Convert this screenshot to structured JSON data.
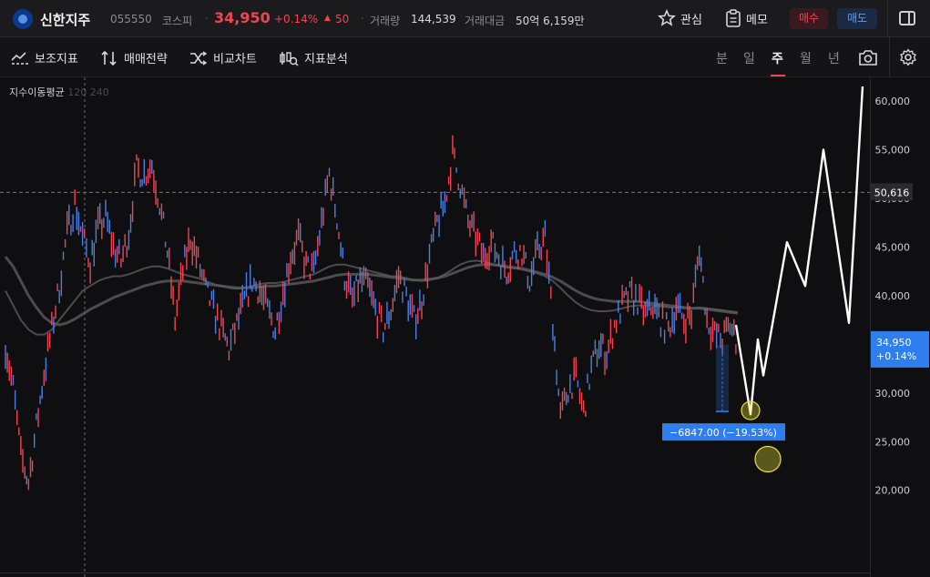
{
  "header": {
    "stock_name": "신한지주",
    "stock_code": "055550",
    "market": "코스피",
    "price": "34,950",
    "change_pct": "+0.14%",
    "change_arrow": "▲",
    "change_amount": "50",
    "volume_label": "거래량",
    "volume_value": "144,539",
    "trade_value_label": "거래대금",
    "trade_value": "50억 6,159만",
    "fav_label": "관심",
    "memo_label": "메모",
    "buy_label": "매수",
    "sell_label": "매도"
  },
  "toolbar": {
    "tools": [
      "보조지표",
      "매매전략",
      "비교차트",
      "지표분석"
    ],
    "periods": [
      "분",
      "일",
      "주",
      "월",
      "년"
    ],
    "active_period": "주"
  },
  "indicator": {
    "name": "지수이동평균",
    "params": "120 240"
  },
  "colors": {
    "up": "#f04452",
    "down": "#4a7fe0",
    "accent_blue": "#2f7ef0",
    "ma": "#5a5a60",
    "drawing": "#ffffff",
    "marker": "#e8e03a"
  },
  "chart_data": {
    "type": "line",
    "title": "",
    "xlabel": "",
    "ylabel": "",
    "ylim": [
      17000,
      61500
    ],
    "y_ticks": [
      "60,000",
      "55,000",
      "50,000",
      "45,000",
      "40,000",
      "35,000",
      "30,000",
      "25,000",
      "20,000"
    ],
    "y_tick_values": [
      60000,
      55000,
      50000,
      45000,
      40000,
      35000,
      30000,
      25000,
      20000
    ],
    "grid": false,
    "series": [
      {
        "kind": "price",
        "values": [
          35000,
          30500,
          23500,
          20800,
          26500,
          32000,
          36500,
          41000,
          46500,
          49500,
          46000,
          43500,
          47000,
          48000,
          45000,
          43500,
          46500,
          53000,
          52500,
          53500,
          49500,
          44500,
          37500,
          42500,
          46000,
          43500,
          40500,
          38500,
          36500,
          34500,
          37000,
          39500,
          41500,
          40500,
          38500,
          36500,
          40500,
          44000,
          46000,
          43000,
          42500,
          47500,
          52500,
          48000,
          42000,
          39500,
          41500,
          41000,
          38500,
          36500,
          38500,
          42000,
          40000,
          37500,
          39500,
          44000,
          47500,
          49500,
          54500,
          51500,
          47500,
          46000,
          44000,
          45500,
          44000,
          42500,
          44500,
          44500,
          41500,
          44500,
          46000,
          37500,
          27500,
          30500,
          31500,
          28000,
          32500,
          35000,
          34000,
          37000,
          39000,
          40000,
          39500,
          38000,
          39000,
          37500,
          36500,
          39000,
          37500,
          38000,
          45000,
          37500,
          36000,
          35500,
          37000,
          34950
        ]
      },
      {
        "kind": "ma120",
        "values": [
          40500,
          39000,
          37500,
          36500,
          36000,
          36000,
          36500,
          37500,
          38500,
          39500,
          40500,
          41000,
          41500,
          41800,
          42000,
          42000,
          42200,
          42500,
          42800,
          43000,
          43000,
          42800,
          42500,
          42200,
          42000,
          41800,
          41500,
          41200,
          41000,
          40800,
          40700,
          40800,
          41000,
          41200,
          41300,
          41300,
          41400,
          41600,
          41800,
          42000,
          42200,
          42600,
          43000,
          43200,
          43200,
          43000,
          42800,
          42600,
          42400,
          42200,
          42000,
          42000,
          41800,
          41600,
          41500,
          41600,
          41800,
          42200,
          42700,
          43200,
          43500,
          43600,
          43500,
          43300,
          43100,
          42900,
          42800,
          42700,
          42500,
          42300,
          42000,
          41500,
          40800,
          40000,
          39300,
          38800,
          38500,
          38400,
          38400,
          38500,
          38700,
          38900,
          39000,
          39000,
          39000,
          38900,
          38800,
          38800,
          38700,
          38700,
          38800,
          38700,
          38600,
          38500,
          38400,
          38300
        ]
      },
      {
        "kind": "ma240",
        "values": [
          44000,
          43000,
          41500,
          40000,
          38800,
          37800,
          37200,
          37000,
          37200,
          37600,
          38100,
          38600,
          39000,
          39400,
          39800,
          40100,
          40400,
          40700,
          41000,
          41200,
          41400,
          41500,
          41500,
          41500,
          41400,
          41300,
          41200,
          41100,
          41000,
          40900,
          40800,
          40800,
          40800,
          40900,
          41000,
          41000,
          41100,
          41200,
          41300,
          41400,
          41500,
          41700,
          41900,
          42100,
          42200,
          42200,
          42200,
          42200,
          42100,
          42000,
          41900,
          41800,
          41700,
          41600,
          41600,
          41700,
          41800,
          42000,
          42300,
          42600,
          42900,
          43100,
          43200,
          43200,
          43100,
          43000,
          42900,
          42800,
          42600,
          42400,
          42200,
          41900,
          41500,
          41000,
          40500,
          40100,
          39800,
          39600,
          39500,
          39400,
          39400,
          39400,
          39400,
          39300,
          39200,
          39100,
          39000,
          38900,
          38800,
          38700,
          38700,
          38600,
          38500,
          38400,
          38300,
          38200
        ]
      }
    ],
    "projection": [
      37000,
      27800,
      35500,
      31800,
      45500,
      41000,
      55000,
      37200,
      61500
    ],
    "current_price_label": "34,950",
    "current_change_label": "+0.14%",
    "current_price": 34950,
    "dashed_level_label": "50,616",
    "dashed_level": 50616,
    "measure_label": "−6847.00 (−19.53%)",
    "measure_from": 34950,
    "measure_to": 28100,
    "marker_prices": [
      28200,
      23200
    ]
  }
}
